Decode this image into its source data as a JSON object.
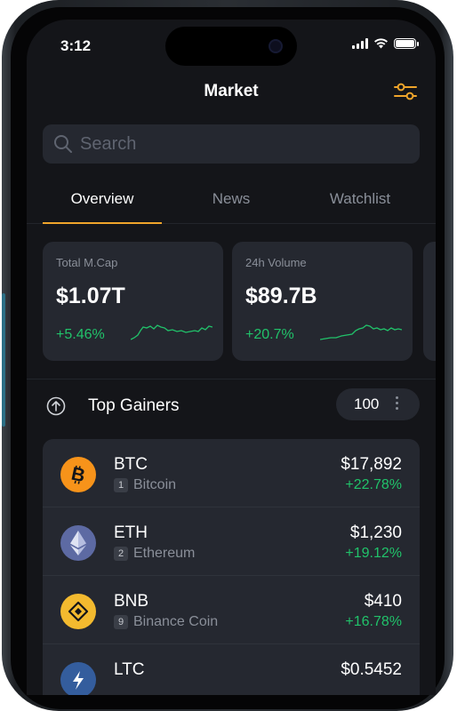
{
  "status_bar": {
    "time": "3:12"
  },
  "header": {
    "title": "Market",
    "filter_icon": "sliders-icon"
  },
  "search": {
    "placeholder": "Search",
    "value": ""
  },
  "tabs": [
    {
      "label": "Overview",
      "active": true
    },
    {
      "label": "News",
      "active": false
    },
    {
      "label": "Watchlist",
      "active": false
    }
  ],
  "cards": [
    {
      "label": "Total M.Cap",
      "value": "$1.07T",
      "change": "+5.46%"
    },
    {
      "label": "24h Volume",
      "value": "$89.7B",
      "change": "+20.7%"
    }
  ],
  "gainers": {
    "title": "Top Gainers",
    "count": "100"
  },
  "coins": [
    {
      "symbol": "BTC",
      "rank": "1",
      "name": "Bitcoin",
      "price": "$17,892",
      "change": "+22.78%",
      "icon": "bitcoin-icon"
    },
    {
      "symbol": "ETH",
      "rank": "2",
      "name": "Ethereum",
      "price": "$1,230",
      "change": "+19.12%",
      "icon": "ethereum-icon"
    },
    {
      "symbol": "BNB",
      "rank": "9",
      "name": "Binance Coin",
      "price": "$410",
      "change": "+16.78%",
      "icon": "binance-icon"
    },
    {
      "symbol": "LTC",
      "rank": "",
      "name": "",
      "price": "$0.5452",
      "change": "",
      "icon": "litecoin-icon"
    }
  ],
  "colors": {
    "accent": "#f0a52b",
    "positive": "#21c26a",
    "background": "#141519",
    "surface": "#252830"
  }
}
